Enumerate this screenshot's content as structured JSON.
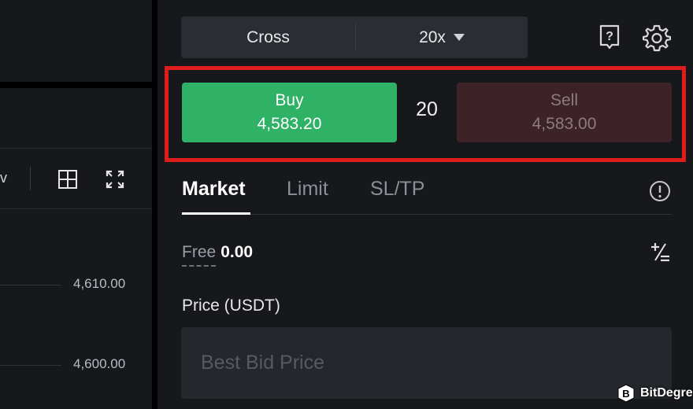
{
  "chart": {
    "view_label": "v",
    "price_ticks": [
      "4,610.00",
      "4,600.00"
    ]
  },
  "margin": {
    "mode_label": "Cross",
    "leverage_label": "20x"
  },
  "order": {
    "buy_label": "Buy",
    "buy_price": "4,583.20",
    "spread": "20",
    "sell_label": "Sell",
    "sell_price": "4,583.00"
  },
  "tabs": [
    {
      "label": "Market",
      "active": true
    },
    {
      "label": "Limit",
      "active": false
    },
    {
      "label": "SL/TP",
      "active": false
    }
  ],
  "balance": {
    "free_label": "Free",
    "free_value": "0.00"
  },
  "price_field": {
    "label": "Price (USDT)",
    "placeholder": "Best Bid Price"
  },
  "watermark": {
    "text": "BitDegree"
  },
  "colors": {
    "buy": "#2fb166",
    "sell": "#3d2327",
    "highlight": "#e01d1d",
    "panel_bg": "#16181c"
  },
  "icons": [
    "layout-grid-icon",
    "fullscreen-icon",
    "help-icon",
    "gear-icon",
    "info-icon",
    "plus-minus-icon",
    "bitdegree-logo-icon"
  ]
}
